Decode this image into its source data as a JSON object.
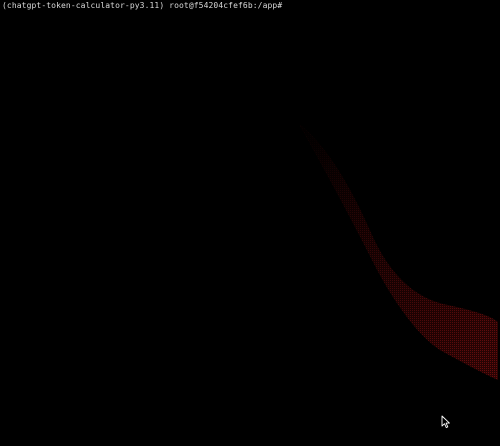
{
  "terminal": {
    "prompt": "(chatgpt-token-calculator-py3.11) root@f54204cfef6b:/app#",
    "background_color": "#000000",
    "text_color": "#d9d9d9",
    "overlay_color": "#5a0a0a"
  },
  "pointer": {
    "icon": "mouse-pointer-icon"
  }
}
